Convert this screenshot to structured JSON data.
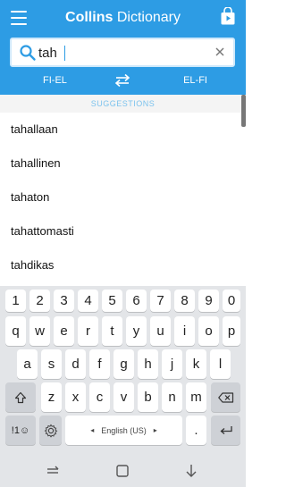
{
  "header": {
    "title_bold": "Collins",
    "title_rest": "Dictionary"
  },
  "search": {
    "value": "tah",
    "placeholder": ""
  },
  "languages": {
    "left": "FI-EL",
    "right": "EL-FI"
  },
  "suggestions": {
    "label": "SUGGESTIONS",
    "items": [
      "tahallaan",
      "tahallinen",
      "tahaton",
      "tahattomasti",
      "tahdikas"
    ]
  },
  "keyboard": {
    "numbers": [
      "1",
      "2",
      "3",
      "4",
      "5",
      "6",
      "7",
      "8",
      "9",
      "0"
    ],
    "row1": [
      "q",
      "w",
      "e",
      "r",
      "t",
      "y",
      "u",
      "i",
      "o",
      "p"
    ],
    "row2": [
      "a",
      "s",
      "d",
      "f",
      "g",
      "h",
      "j",
      "k",
      "l"
    ],
    "row3": [
      "z",
      "x",
      "c",
      "v",
      "b",
      "n",
      "m"
    ],
    "sym_label": "!1☺",
    "space_label": "English (US)",
    "period": ".",
    "comma": ","
  },
  "colors": {
    "brand": "#2d9ce4",
    "suggestion_label": "#7cc3ee"
  }
}
